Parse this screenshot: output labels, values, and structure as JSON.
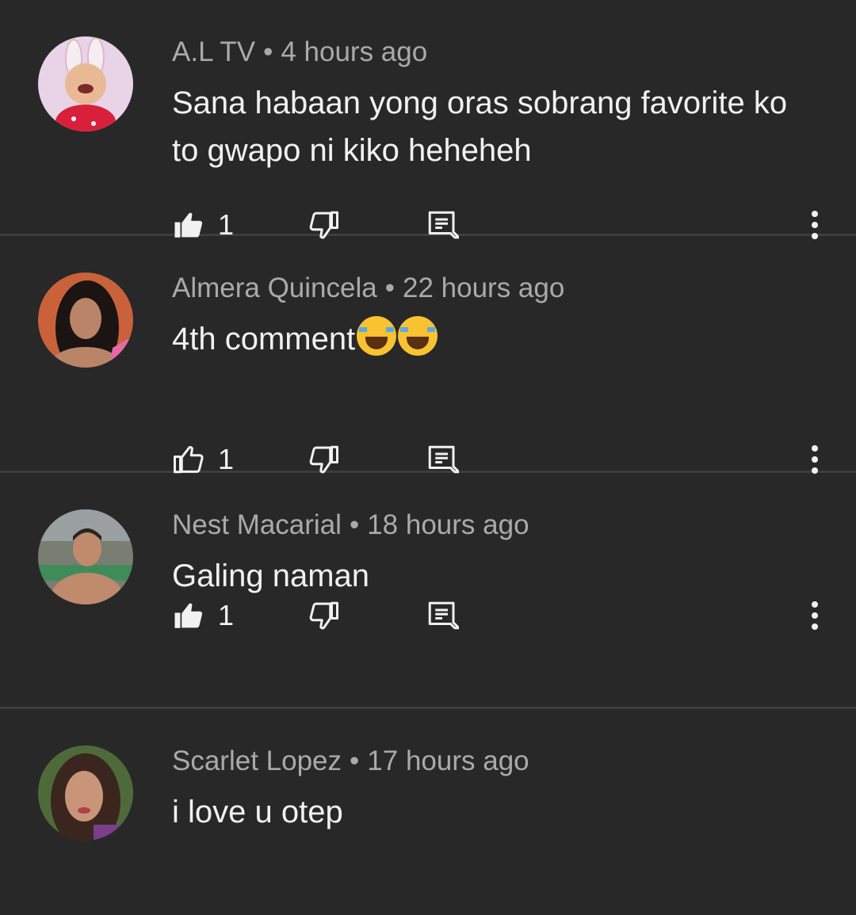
{
  "comments": [
    {
      "author": "A.L TV",
      "time": "4 hours ago",
      "text": "Sana habaan yong oras sobrang favorite ko to gwapo ni kiko heheheh",
      "likes": "1",
      "liked": true,
      "avatar": "baby-bunny-ears-avatar",
      "avatar_colors": {
        "bg": "#e8d4e6",
        "skin": "#e9b996",
        "accent": "#d8203b"
      }
    },
    {
      "author": "Almera Quincela",
      "time": "22 hours ago",
      "text": "4th comment",
      "emoji": [
        "😂",
        "😂"
      ],
      "likes": "1",
      "liked": false,
      "avatar": "woman-avatar",
      "avatar_colors": {
        "bg": "#c9623a",
        "skin": "#b98468",
        "accent": "#1b1412"
      }
    },
    {
      "author": "Nest Macarial",
      "time": "18 hours ago",
      "text": "Galing naman",
      "likes": "1",
      "liked": true,
      "avatar": "man-avatar",
      "avatar_colors": {
        "bg": "#7a7d72",
        "skin": "#c08a6c",
        "accent": "#2a2420"
      }
    },
    {
      "author": "Scarlet Lopez",
      "time": "17 hours ago",
      "text": "i love u otep",
      "likes": "",
      "liked": false,
      "avatar": "woman-selfie-avatar",
      "avatar_colors": {
        "bg": "#4f6a3a",
        "skin": "#c99578",
        "accent": "#3a261e"
      }
    }
  ],
  "separator": "•",
  "icons": {
    "like": "thumbs-up-icon",
    "dislike": "thumbs-down-icon",
    "reply": "reply-icon",
    "more": "more-vertical-icon"
  },
  "colors": {
    "background": "#282828",
    "divider": "#3d3d3d",
    "text": "#f1f1f1",
    "meta": "#aaaaaa"
  }
}
